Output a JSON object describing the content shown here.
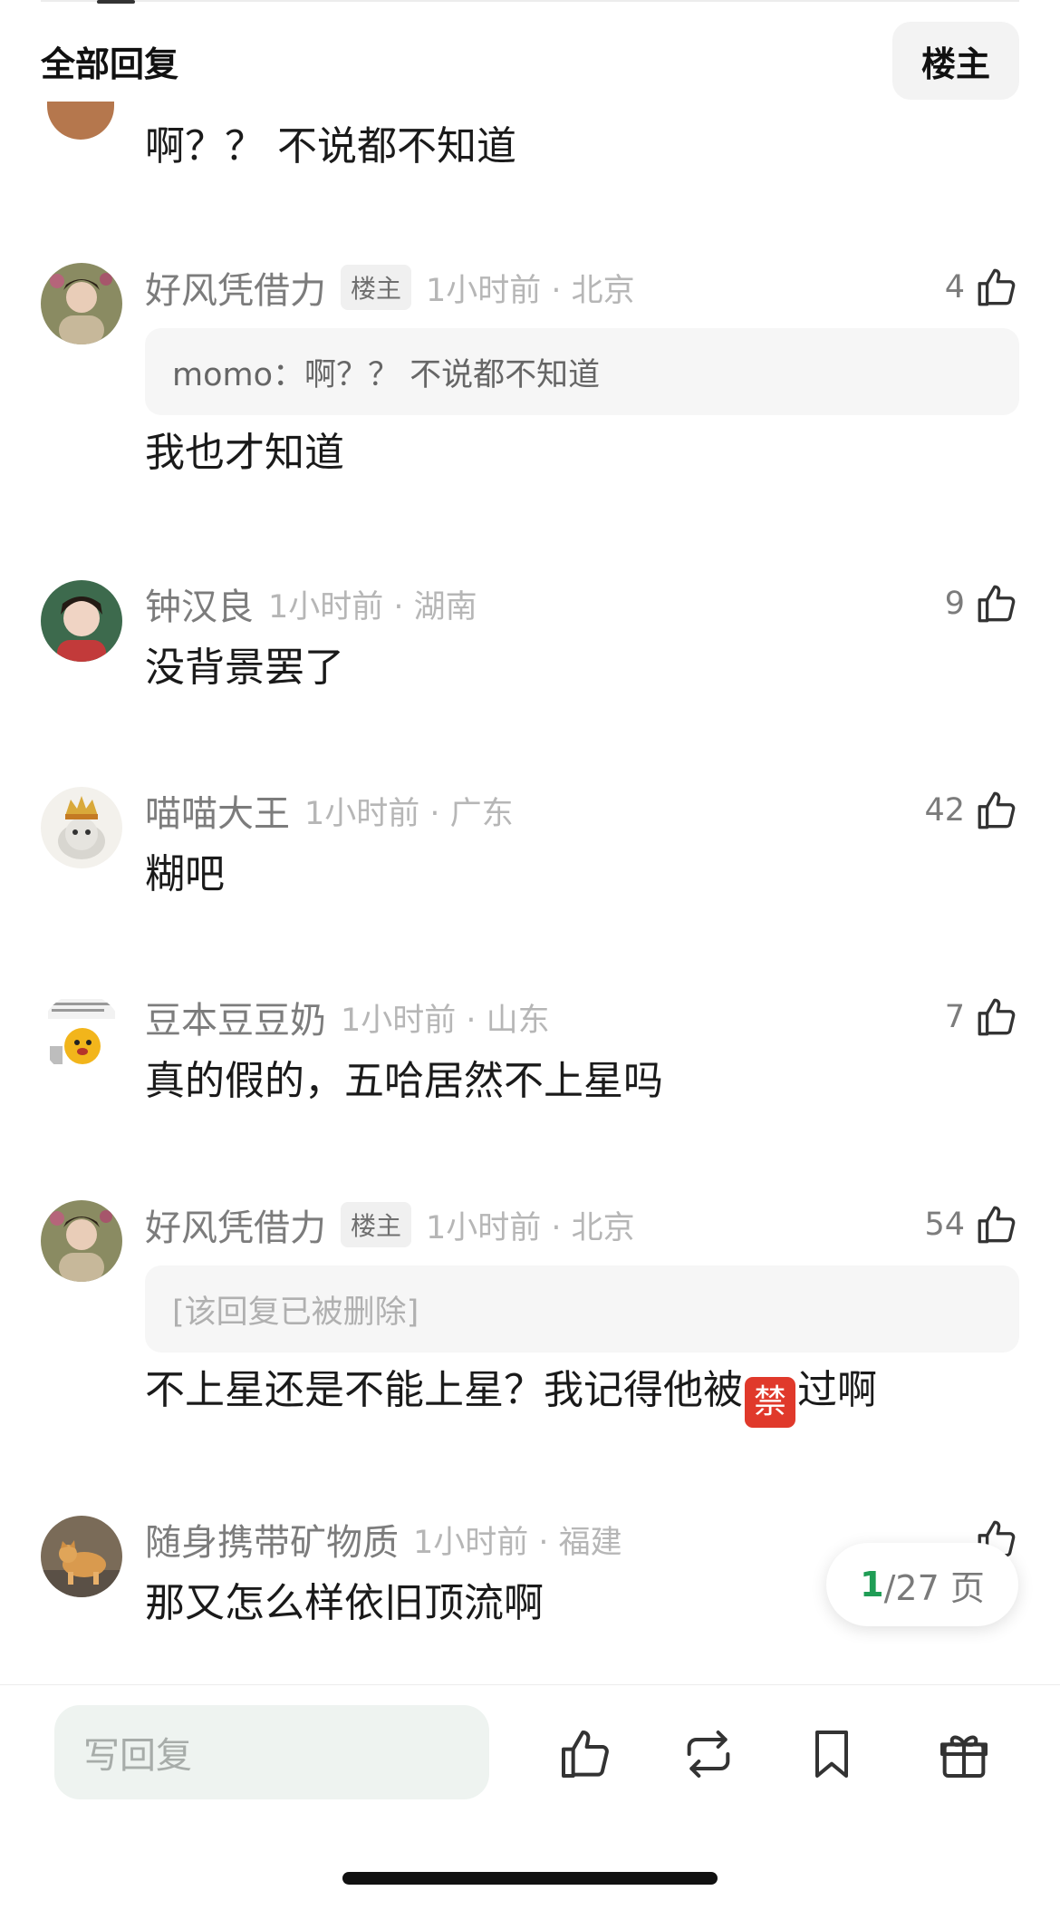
{
  "header": {
    "title": "全部回复",
    "filter_label": "楼主"
  },
  "partial_comment": {
    "text": "啊？？ 不说都不知道"
  },
  "comments": [
    {
      "username": "好风凭借力",
      "op_tag": "楼主",
      "meta": "1小时前 · 北京",
      "likes": "4",
      "quote": "momo：啊？？ 不说都不知道",
      "text": "我也才知道"
    },
    {
      "username": "钟汉良",
      "meta": "1小时前 · 湖南",
      "likes": "9",
      "text": "没背景罢了"
    },
    {
      "username": "喵喵大王",
      "meta": "1小时前 · 广东",
      "likes": "42",
      "text": "糊吧"
    },
    {
      "username": "豆本豆豆奶",
      "meta": "1小时前 · 山东",
      "likes": "7",
      "text": "真的假的，五哈居然不上星吗"
    },
    {
      "username": "好风凭借力",
      "op_tag": "楼主",
      "meta": "1小时前 · 北京",
      "likes": "54",
      "quote": "[该回复已被删除]",
      "text_before": "不上星还是不能上星？我记得他被",
      "ban_glyph": "禁",
      "text_after": "过啊"
    },
    {
      "username": "随身携带矿物质",
      "meta": "1小时前 · 福建",
      "text": "那又怎么样依旧顶流啊"
    }
  ],
  "pager": {
    "current": "1",
    "rest": "/27 页"
  },
  "bottom_bar": {
    "reply_placeholder": "写回复",
    "icons": [
      "thumb-up-icon",
      "repost-icon",
      "bookmark-icon",
      "gift-icon"
    ]
  },
  "colors": {
    "username": "#7c7c7c",
    "meta": "#b6b6b6",
    "accent_green": "#1f9d55",
    "ban_red": "#e0392b"
  }
}
